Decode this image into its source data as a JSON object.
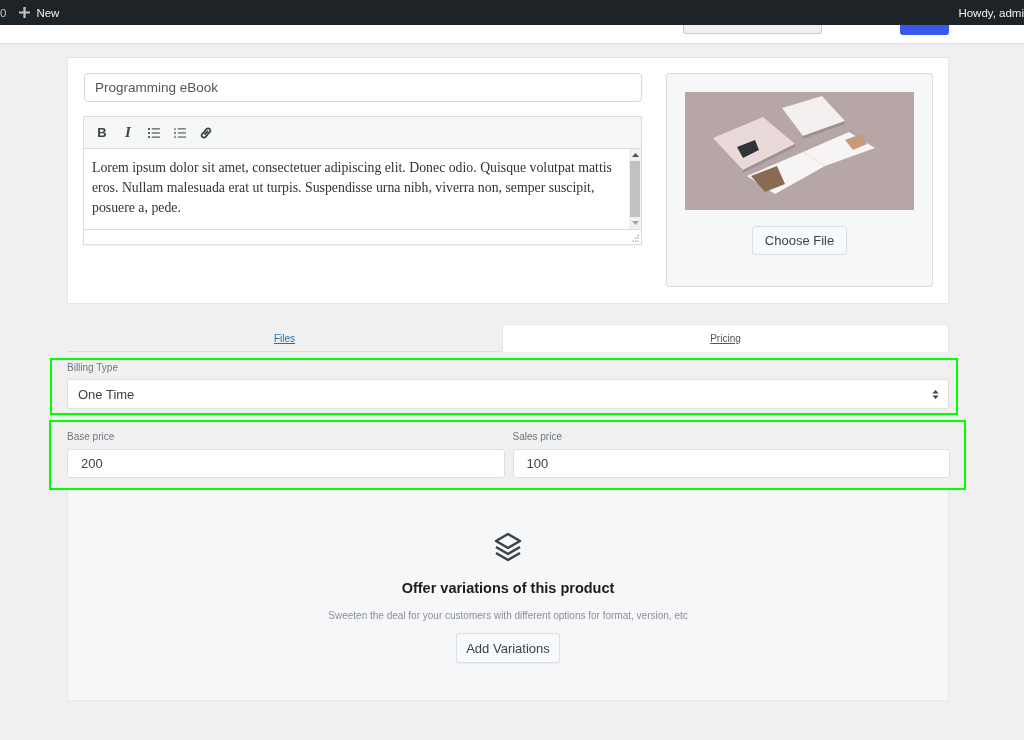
{
  "admin_bar": {
    "comment_count": "0",
    "new_label": "New",
    "greeting": "Howdy, admi"
  },
  "product": {
    "title": "Programming eBook",
    "editor": {
      "toolbar": [
        {
          "kind": "bold",
          "glyph": "B"
        },
        {
          "kind": "italic",
          "glyph": "I"
        },
        {
          "kind": "bullet-list"
        },
        {
          "kind": "numbered-list"
        },
        {
          "kind": "link"
        }
      ],
      "content": "Lorem ipsum dolor sit amet, consectetuer adipiscing elit. Donec odio. Quisque volutpat mattis eros. Nullam malesuada erat ut turpis. Suspendisse urna nibh, viverra non, semper suscipit, posuere a, pede."
    },
    "media": {
      "button": "Choose File"
    }
  },
  "tabs": [
    {
      "label": "Files",
      "selected": false
    },
    {
      "label": "Pricing",
      "selected": true
    }
  ],
  "billing": {
    "highlighted": true,
    "label": "Billing Type",
    "value": "One Time"
  },
  "prices": {
    "highlighted": true,
    "fields": [
      {
        "label": "Base price",
        "value": "200"
      },
      {
        "label": "Sales price",
        "value": "100"
      }
    ]
  },
  "variations": {
    "heading": "Offer variations of this product",
    "description": "Sweeten the deal for your customers with different options for format, version, etc",
    "button": "Add Variations"
  }
}
